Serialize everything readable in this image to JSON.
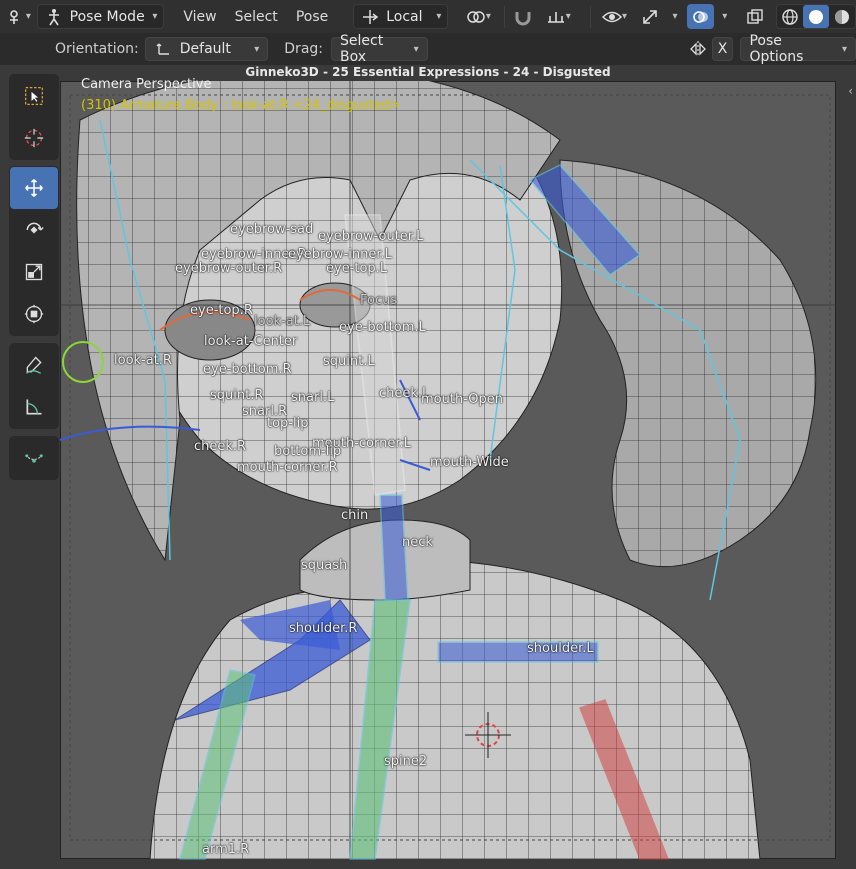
{
  "header": {
    "editor_type_icon": "armature-editor-icon",
    "mode": "Pose Mode",
    "menus": [
      "View",
      "Select",
      "Pose"
    ],
    "transform_orientation": "Local",
    "pivot_icon": "pivot-icon",
    "snap_icon": "magnet-icon",
    "proportional_icon": "proportional-icon",
    "visibility_icon": "eye-icon",
    "gizmo_icon": "gizmo-icon",
    "overlay_icon": "overlay-icon",
    "xray_icon": "xray-icon",
    "shading_icons": [
      "wireframe-shading-icon",
      "solid-shading-icon",
      "material-shading-icon"
    ]
  },
  "subheader": {
    "orientation_label": "Orientation:",
    "orientation_value": "Default",
    "drag_label": "Drag:",
    "drag_value": "Select Box",
    "x_label": "X",
    "pose_options": "Pose Options"
  },
  "viewport": {
    "title": "Ginneko3D - 25 Essential Expressions - 24 - Disgusted",
    "camera_text": "Camera Perspective",
    "active_text": "(310) Armature.Body : look-at.R <24_disgusted>"
  },
  "toolbar": {
    "tools": [
      "select-box-icon",
      "cursor-icon",
      "move-icon",
      "rotate-icon",
      "scale-icon",
      "transform-icon",
      "annotate-icon",
      "measure-icon",
      "pose-relax-icon"
    ],
    "active_tool": "move-icon"
  },
  "bones": {
    "eyebrow_sad": "eyebrow-sad",
    "eyebrow_outer_l": "eyebrow-outer.L",
    "eyebrow_inner_r": "eyebrow-inner.R",
    "eyebrow_inner_l": "eyebrow-inner.L",
    "eyebrow_outer_r": "eyebrow-outer.R",
    "eye_top_l": "eye-top.L",
    "focus": "Focus",
    "eye_top_r": "eye-top.R",
    "look_at_l": "look-at.L",
    "eye_bottom_l": "eye-bottom.L",
    "look_at_center": "look-at-Center",
    "look_at_r": "look-at.R",
    "squint_l": "squint.L",
    "eye_bottom_r": "eye-bottom.R",
    "cheek_l": "cheek.L",
    "squint_r": "squint.R",
    "snarl_l": "snarl.L",
    "mouth_open": "mouth-Open",
    "snarl_r": "snarl.R",
    "top_lip": "top-lip",
    "mouth_corner_l": "mouth-corner.L",
    "cheek_r": "cheek.R",
    "bottom_lip": "bottom-lip",
    "mouth_wide": "mouth-Wide",
    "mouth_corner_r": "mouth-corner.R",
    "chin": "chin",
    "neck": "neck",
    "squash": "squash",
    "shoulder_r": "shoulder.R",
    "shoulder_l": "shoulder.L",
    "spine2": "spine2",
    "arm1_r": "arm1.R"
  },
  "colors": {
    "accent": "#4772b3",
    "header_bg": "#303030",
    "active_text": "#d4c400",
    "bone_blue": "#3a5bd6",
    "bone_green": "#5fc27a",
    "bone_red": "#d23a3a"
  }
}
